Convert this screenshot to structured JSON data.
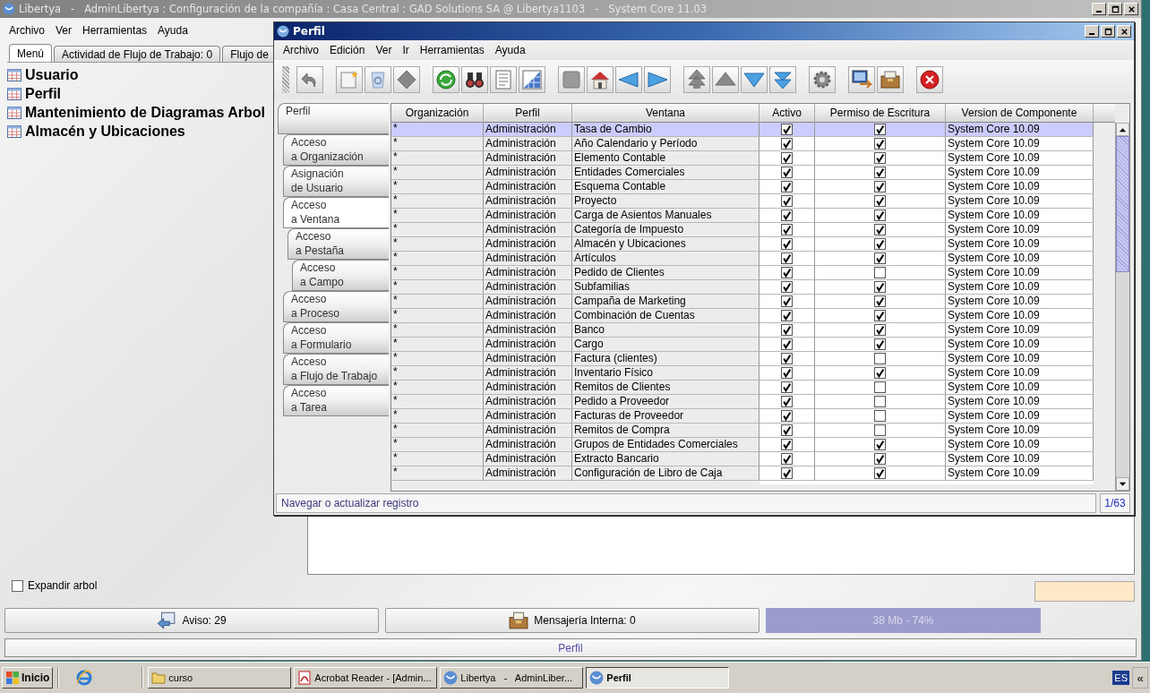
{
  "main_window": {
    "title": "Libertya   -   AdminLibertya : Configuración de la compañía : Casa Central : GAD Solutions SA @ Libertya1103   -   System Core 11.03",
    "menu": [
      "Archivo",
      "Ver",
      "Herramientas",
      "Ayuda"
    ],
    "tabs": [
      {
        "label": "Menú",
        "selected": true
      },
      {
        "label": "Actividad de Flujo de Trabajo: 0",
        "selected": false
      },
      {
        "label": "Flujo de",
        "selected": false
      }
    ],
    "tree_items": [
      "Usuario",
      "Perfil",
      "Mantenimiento de Diagramas Arbol",
      "Almacén y Ubicaciones"
    ],
    "expand_tree": {
      "label": "Expandir arbol",
      "checked": false
    },
    "buttons": [
      {
        "label": "Aviso: 29",
        "kind": "notice"
      },
      {
        "label": "Mensajería Interna: 0",
        "kind": "messages"
      }
    ],
    "memory": "38 Mb - 74%",
    "status": "Perfil"
  },
  "dialog": {
    "title": "Perfil",
    "menu": [
      "Archivo",
      "Edición",
      "Ver",
      "Ir",
      "Herramientas",
      "Ayuda"
    ],
    "side_tabs": [
      {
        "label": "Perfil",
        "selected": false,
        "children": [
          {
            "label": "Acceso\na Organización",
            "selected": false
          },
          {
            "label": "Asignación\nde Usuario",
            "selected": false
          },
          {
            "label": "Acceso\na Ventana",
            "selected": true,
            "children": [
              {
                "label": "Acceso\na Pestaña",
                "selected": false,
                "children": [
                  {
                    "label": "Acceso\na Campo",
                    "selected": false
                  }
                ]
              }
            ]
          },
          {
            "label": "Acceso\na Proceso",
            "selected": false
          },
          {
            "label": "Acceso\na Formulario",
            "selected": false
          },
          {
            "label": "Acceso\na Flujo de Trabajo",
            "selected": false
          },
          {
            "label": "Acceso\na Tarea",
            "selected": false
          }
        ]
      }
    ],
    "table": {
      "columns": [
        "Organización",
        "Perfil",
        "Ventana",
        "Activo",
        "Permiso de Escritura",
        "Version de Componente"
      ],
      "rows": [
        {
          "organization": "*",
          "profile": "Administración",
          "window": "Tasa de Cambio",
          "active": true,
          "write_access": true,
          "version": "System Core 10.09",
          "selected": true
        },
        {
          "organization": "*",
          "profile": "Administración",
          "window": "Año Calendario y Período",
          "active": true,
          "write_access": true,
          "version": "System Core 10.09",
          "selected": false
        },
        {
          "organization": "*",
          "profile": "Administración",
          "window": "Elemento Contable",
          "active": true,
          "write_access": true,
          "version": "System Core 10.09",
          "selected": false
        },
        {
          "organization": "*",
          "profile": "Administración",
          "window": "Entidades Comerciales",
          "active": true,
          "write_access": true,
          "version": "System Core 10.09",
          "selected": false
        },
        {
          "organization": "*",
          "profile": "Administración",
          "window": "Esquema Contable",
          "active": true,
          "write_access": true,
          "version": "System Core 10.09",
          "selected": false
        },
        {
          "organization": "*",
          "profile": "Administración",
          "window": "Proyecto",
          "active": true,
          "write_access": true,
          "version": "System Core 10.09",
          "selected": false
        },
        {
          "organization": "*",
          "profile": "Administración",
          "window": "Carga de Asientos Manuales",
          "active": true,
          "write_access": true,
          "version": "System Core 10.09",
          "selected": false
        },
        {
          "organization": "*",
          "profile": "Administración",
          "window": "Categoría de Impuesto",
          "active": true,
          "write_access": true,
          "version": "System Core 10.09",
          "selected": false
        },
        {
          "organization": "*",
          "profile": "Administración",
          "window": "Almacén y Ubicaciones",
          "active": true,
          "write_access": true,
          "version": "System Core 10.09",
          "selected": false
        },
        {
          "organization": "*",
          "profile": "Administración",
          "window": "Artículos",
          "active": true,
          "write_access": true,
          "version": "System Core 10.09",
          "selected": false
        },
        {
          "organization": "*",
          "profile": "Administración",
          "window": "Pedido de Clientes",
          "active": true,
          "write_access": false,
          "version": "System Core 10.09",
          "selected": false
        },
        {
          "organization": "*",
          "profile": "Administración",
          "window": "Subfamilias",
          "active": true,
          "write_access": true,
          "version": "System Core 10.09",
          "selected": false
        },
        {
          "organization": "*",
          "profile": "Administración",
          "window": "Campaña de Marketing",
          "active": true,
          "write_access": true,
          "version": "System Core 10.09",
          "selected": false
        },
        {
          "organization": "*",
          "profile": "Administración",
          "window": "Combinación de Cuentas",
          "active": true,
          "write_access": true,
          "version": "System Core 10.09",
          "selected": false
        },
        {
          "organization": "*",
          "profile": "Administración",
          "window": "Banco",
          "active": true,
          "write_access": true,
          "version": "System Core 10.09",
          "selected": false
        },
        {
          "organization": "*",
          "profile": "Administración",
          "window": "Cargo",
          "active": true,
          "write_access": true,
          "version": "System Core 10.09",
          "selected": false
        },
        {
          "organization": "*",
          "profile": "Administración",
          "window": "Factura (clientes)",
          "active": true,
          "write_access": false,
          "version": "System Core 10.09",
          "selected": false
        },
        {
          "organization": "*",
          "profile": "Administración",
          "window": "Inventario Físico",
          "active": true,
          "write_access": true,
          "version": "System Core 10.09",
          "selected": false
        },
        {
          "organization": "*",
          "profile": "Administración",
          "window": "Remitos de Clientes",
          "active": true,
          "write_access": false,
          "version": "System Core 10.09",
          "selected": false
        },
        {
          "organization": "*",
          "profile": "Administración",
          "window": "Pedido a Proveedor",
          "active": true,
          "write_access": false,
          "version": "System Core 10.09",
          "selected": false
        },
        {
          "organization": "*",
          "profile": "Administración",
          "window": "Facturas de Proveedor",
          "active": true,
          "write_access": false,
          "version": "System Core 10.09",
          "selected": false
        },
        {
          "organization": "*",
          "profile": "Administración",
          "window": "Remitos de Compra",
          "active": true,
          "write_access": false,
          "version": "System Core 10.09",
          "selected": false
        },
        {
          "organization": "*",
          "profile": "Administración",
          "window": "Grupos de Entidades Comerciales",
          "active": true,
          "write_access": true,
          "version": "System Core 10.09",
          "selected": false
        },
        {
          "organization": "*",
          "profile": "Administración",
          "window": "Extracto Bancario",
          "active": true,
          "write_access": true,
          "version": "System Core 10.09",
          "selected": false
        },
        {
          "organization": "*",
          "profile": "Administración",
          "window": "Configuración de Libro de Caja",
          "active": true,
          "write_access": true,
          "version": "System Core 10.09",
          "selected": false
        }
      ]
    },
    "status": "Navegar o actualizar registro",
    "record_count": "1/63"
  },
  "taskbar": {
    "start": "Inicio",
    "tasks": [
      {
        "label": "curso",
        "kind": "folder",
        "selected": false
      },
      {
        "label": "Acrobat Reader - [Admin...",
        "kind": "document",
        "selected": false
      },
      {
        "label": "Libertya   -   AdminLiber...",
        "kind": "app",
        "selected": false
      },
      {
        "label": "Perfil",
        "kind": "app",
        "selected": true
      }
    ],
    "language": "ES",
    "collapse": "«"
  }
}
